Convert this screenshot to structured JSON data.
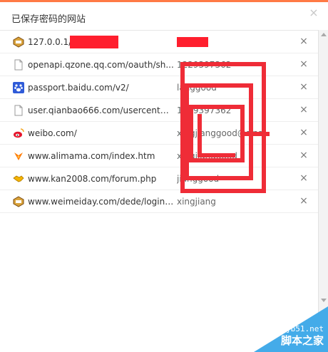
{
  "dialog": {
    "title": "已保存密码的网站",
    "close_label": "×"
  },
  "rows": [
    {
      "icon": "site-icon-127",
      "url": "127.0.0.1/",
      "user": ""
    },
    {
      "icon": "document-icon",
      "url": "openapi.qzone.qq.com/oauth/sh...",
      "user": "1229397362"
    },
    {
      "icon": "baidu-paw-icon",
      "url": "passport.baidu.com/v2/",
      "user": "langgood"
    },
    {
      "icon": "document-icon",
      "url": "user.qianbao666.com/usercenter...",
      "user": "1229397362"
    },
    {
      "icon": "weibo-icon",
      "url": "weibo.com/",
      "user": "xingjianggood@sina.com"
    },
    {
      "icon": "alimama-icon",
      "url": "www.alimama.com/index.htm",
      "user": "xingjianggood"
    },
    {
      "icon": "handshake-icon",
      "url": "www.kan2008.com/forum.php",
      "user": "jianggood"
    },
    {
      "icon": "site-icon-generic",
      "url": "www.weimeiday.com/dede/login....",
      "user": "xingjiang"
    }
  ],
  "row_delete_label": "×",
  "watermark": {
    "line1": "jb51.net",
    "line2": "脚本之家"
  },
  "colors": {
    "topbar": "#ff7a45",
    "redact": "#ff1f2e",
    "watermark_bg": "#3aa7e8"
  }
}
